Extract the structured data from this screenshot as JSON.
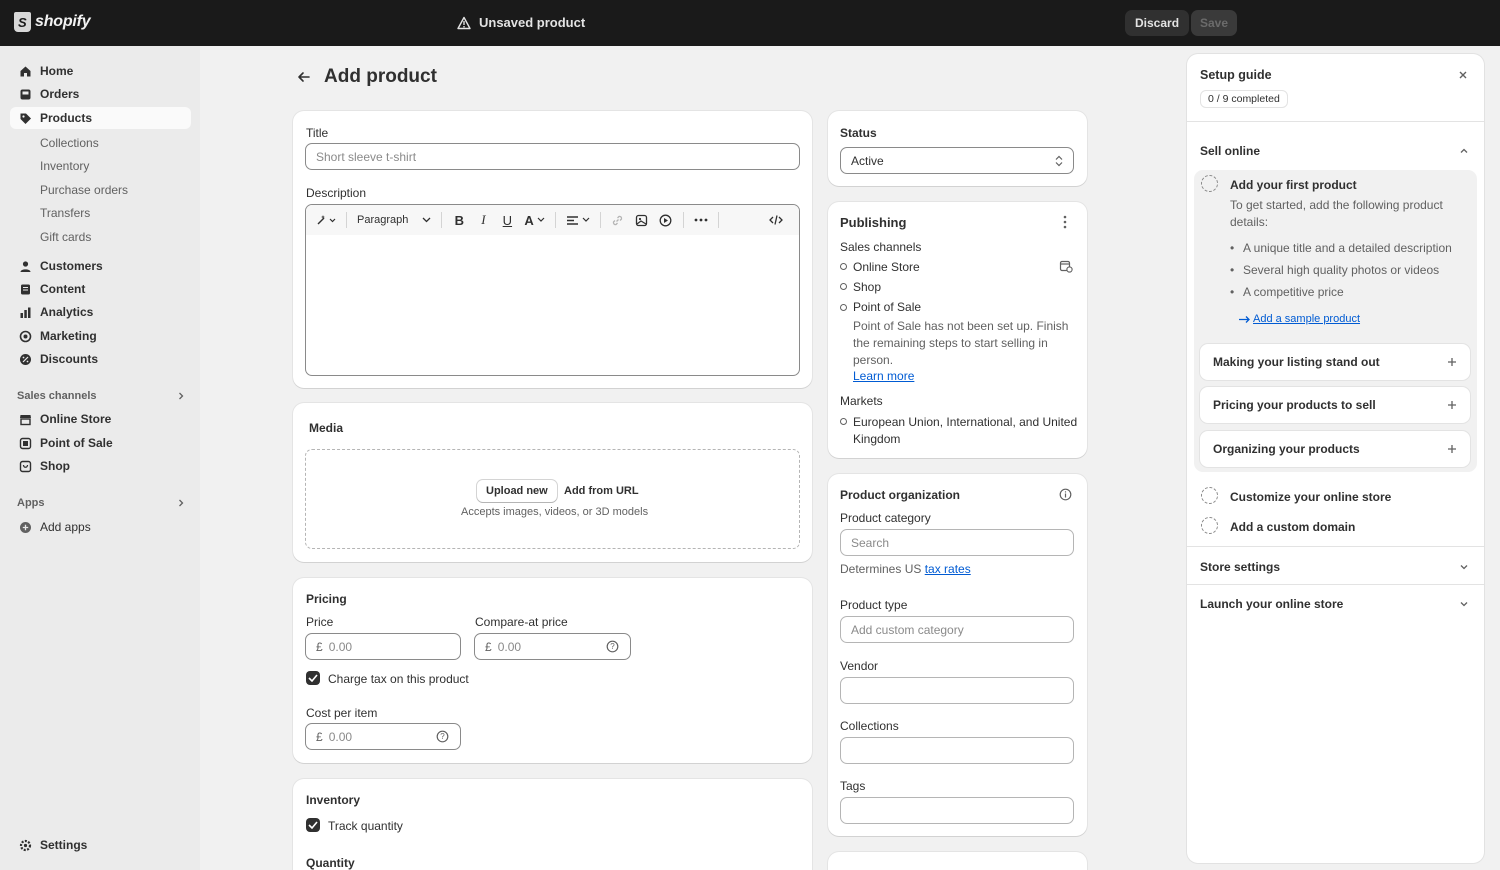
{
  "topbar": {
    "brand": "shopify",
    "status": "Unsaved product",
    "discard": "Discard",
    "save": "Save"
  },
  "sidebar": {
    "items": [
      {
        "label": "Home"
      },
      {
        "label": "Orders"
      },
      {
        "label": "Products"
      },
      {
        "label": "Customers"
      },
      {
        "label": "Content"
      },
      {
        "label": "Analytics"
      },
      {
        "label": "Marketing"
      },
      {
        "label": "Discounts"
      }
    ],
    "product_sub": [
      "Collections",
      "Inventory",
      "Purchase orders",
      "Transfers",
      "Gift cards"
    ],
    "sales_channels_heading": "Sales channels",
    "channels": [
      "Online Store",
      "Point of Sale",
      "Shop"
    ],
    "apps_heading": "Apps",
    "add_apps": "Add apps",
    "settings": "Settings"
  },
  "main": {
    "title": "Add product",
    "title_label": "Title",
    "title_placeholder": "Short sleeve t-shirt",
    "description_label": "Description",
    "paragraph": "Paragraph",
    "media_heading": "Media",
    "upload_new": "Upload new",
    "add_from_url": "Add from URL",
    "media_hint": "Accepts images, videos, or 3D models",
    "pricing_heading": "Pricing",
    "price_label": "Price",
    "compare_label": "Compare-at price",
    "currency": "£",
    "price_placeholder": "0.00",
    "charge_tax": "Charge tax on this product",
    "cost_label": "Cost per item",
    "inventory_heading": "Inventory",
    "track_quantity": "Track quantity",
    "quantity_heading": "Quantity"
  },
  "status_card": {
    "heading": "Status",
    "value": "Active"
  },
  "publishing": {
    "heading": "Publishing",
    "sales_channels": "Sales channels",
    "channels": [
      "Online Store",
      "Shop",
      "Point of Sale"
    ],
    "pos_note": "Point of Sale has not been set up. Finish the remaining steps to start selling in person.",
    "learn_more": "Learn more",
    "markets_heading": "Markets",
    "markets_value": "European Union, International, and United Kingdom"
  },
  "organization": {
    "heading": "Product organization",
    "category_label": "Product category",
    "category_placeholder": "Search",
    "determines": "Determines US",
    "tax_rates": "tax rates",
    "type_label": "Product type",
    "type_placeholder": "Add custom category",
    "vendor_label": "Vendor",
    "collections_label": "Collections",
    "tags_label": "Tags"
  },
  "guide": {
    "heading": "Setup guide",
    "progress": "0 / 9 completed",
    "sell_online": "Sell online",
    "first_product_title": "Add your first product",
    "first_product_desc": "To get started, add the following product details:",
    "bullets": [
      "A unique title and a detailed description",
      "Several high quality photos or videos",
      "A competitive price"
    ],
    "sample_link": "Add a sample product",
    "tasks": [
      "Making your listing stand out",
      "Pricing your products to sell",
      "Organizing your products"
    ],
    "customize": "Customize your online store",
    "domain": "Add a custom domain",
    "store_settings": "Store settings",
    "launch": "Launch your online store"
  }
}
